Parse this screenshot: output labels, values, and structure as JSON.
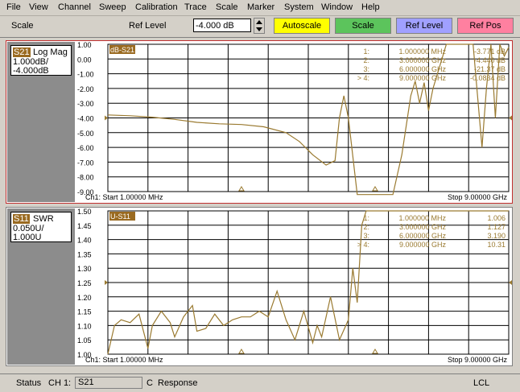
{
  "menu": [
    "File",
    "View",
    "Channel",
    "Sweep",
    "Calibration",
    "Trace",
    "Scale",
    "Marker",
    "System",
    "Window",
    "Help"
  ],
  "toolbar": {
    "title": "Scale",
    "ref_label": "Ref Level",
    "ref_value": "-4.000 dB",
    "buttons": [
      {
        "label": "Autoscale",
        "color": "#ffff00"
      },
      {
        "label": "Scale",
        "color": "#5cc45c"
      },
      {
        "label": "Ref Level",
        "color": "#a0a0ff"
      },
      {
        "label": "Ref Pos",
        "color": "#ff80a0"
      }
    ]
  },
  "chart_data": [
    {
      "type": "line",
      "trace_tag": "S21",
      "format": "Log Mag",
      "scale": "1.000dB/",
      "ref": "-4.000dB",
      "title": "dB-S21",
      "yticks": [
        "1.00",
        "0.00",
        "-1.00",
        "-2.00",
        "-3.00",
        "-4.00",
        "-5.00",
        "-6.00",
        "-7.00",
        "-8.00",
        "-9.00"
      ],
      "ylim": [
        -9,
        1
      ],
      "xlim": [
        0.001,
        9
      ],
      "start_label": "Ch1: Start  1.00000 MHz",
      "stop_label": "Stop  9.00000 GHz",
      "markers": [
        {
          "id": "1:",
          "freq": "1.000000 MHz",
          "value": "-3.771 dB"
        },
        {
          "id": "2:",
          "freq": "3.000000 GHz",
          "value": "-4.440 dB"
        },
        {
          "id": "3:",
          "freq": "6.000000 GHz",
          "value": "-21.37 dB"
        },
        {
          "id": "> 4:",
          "freq": "9.000000 GHz",
          "value": "-0.0834 dB"
        }
      ],
      "series": [
        {
          "x": [
            0.001,
            0.5,
            1,
            1.5,
            2,
            2.5,
            3,
            3.5,
            4,
            4.3,
            4.6,
            4.9,
            5.1,
            5.2,
            5.3,
            5.4,
            5.6,
            5.9,
            6.0,
            6.2,
            6.4,
            6.6,
            6.8,
            6.9,
            7.0,
            7.1,
            7.2,
            7.3,
            7.4,
            7.6,
            7.8,
            8.0,
            8.2,
            8.4,
            8.5,
            8.6,
            8.7,
            8.8,
            8.9,
            9.0
          ],
          "y": [
            -3.8,
            -3.85,
            -3.95,
            -4.1,
            -4.3,
            -4.4,
            -4.45,
            -4.6,
            -5.0,
            -5.6,
            -6.5,
            -7.2,
            -6.9,
            -4.0,
            -2.5,
            -4.0,
            -10,
            -10,
            -10,
            -10,
            -10,
            -6.5,
            -2.5,
            -1.5,
            -3.0,
            -1.6,
            -3.5,
            -2.0,
            -1.0,
            1.0,
            1.0,
            1.0,
            1.0,
            -6.0,
            -2.0,
            1.0,
            -4.0,
            1.0,
            0.2,
            0.8
          ]
        }
      ]
    },
    {
      "type": "line",
      "trace_tag": "S11",
      "format": "SWR",
      "scale": "0.050U/",
      "ref": "1.000U",
      "title": "U-S11",
      "yticks": [
        "1.50",
        "1.45",
        "1.40",
        "1.35",
        "1.30",
        "1.25",
        "1.20",
        "1.15",
        "1.10",
        "1.05",
        "1.00"
      ],
      "ylim": [
        1.0,
        1.5
      ],
      "xlim": [
        0.001,
        9
      ],
      "start_label": "Ch1: Start  1.00000 MHz",
      "stop_label": "Stop  9.00000 GHz",
      "markers": [
        {
          "id": "1:",
          "freq": "1.000000 MHz",
          "value": "1.006"
        },
        {
          "id": "2:",
          "freq": "3.000000 GHz",
          "value": "1.127"
        },
        {
          "id": "3:",
          "freq": "6.000000 GHz",
          "value": "3.190"
        },
        {
          "id": "> 4:",
          "freq": "9.000000 GHz",
          "value": "10.31"
        }
      ],
      "series": [
        {
          "x": [
            0.001,
            0.15,
            0.3,
            0.5,
            0.7,
            0.9,
            1.0,
            1.2,
            1.4,
            1.5,
            1.7,
            1.9,
            2.0,
            2.2,
            2.4,
            2.6,
            2.8,
            3.0,
            3.2,
            3.4,
            3.6,
            3.8,
            4.0,
            4.2,
            4.4,
            4.6,
            4.7,
            4.8,
            5.0,
            5.2,
            5.4,
            5.5,
            5.6,
            5.7,
            5.8,
            6.0,
            9.0
          ],
          "y": [
            1.0,
            1.1,
            1.12,
            1.11,
            1.14,
            1.02,
            1.1,
            1.15,
            1.11,
            1.06,
            1.13,
            1.17,
            1.08,
            1.09,
            1.14,
            1.1,
            1.12,
            1.13,
            1.13,
            1.15,
            1.13,
            1.22,
            1.12,
            1.05,
            1.15,
            1.04,
            1.1,
            1.06,
            1.2,
            1.05,
            1.12,
            1.3,
            1.18,
            1.45,
            1.55,
            1.55,
            1.55
          ]
        }
      ]
    }
  ],
  "statusbar": {
    "status": "Status",
    "channel": "CH 1:",
    "trace": "S21",
    "mode": "C",
    "response": "Response",
    "lcl": "LCL"
  },
  "colors": {
    "trace": "#9a7a30",
    "grid": "#000000",
    "marker": "#9a6a20"
  }
}
